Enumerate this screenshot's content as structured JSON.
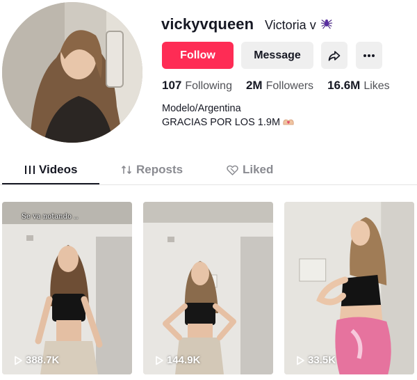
{
  "profile": {
    "username": "vickyvqueen",
    "display_name": "Victoria v",
    "name_emoji": "spider-icon",
    "bio_line1": "Modelo/Argentina",
    "bio_line2": "GRACIAS POR LOS 1.9M",
    "bio_emoji": "heart-hands-icon"
  },
  "actions": {
    "follow_label": "Follow",
    "message_label": "Message",
    "share_icon": "share-icon",
    "more_icon": "more-icon"
  },
  "stats": {
    "following_count": "107",
    "following_label": "Following",
    "followers_count": "2M",
    "followers_label": "Followers",
    "likes_count": "16.6M",
    "likes_label": "Likes"
  },
  "tabs": [
    {
      "label": "Videos",
      "icon": "grid-icon",
      "active": true
    },
    {
      "label": "Reposts",
      "icon": "repost-icon",
      "active": false
    },
    {
      "label": "Liked",
      "icon": "liked-heart-icon",
      "active": false
    }
  ],
  "videos": [
    {
      "views": "388.7K",
      "caption": "Se va notando .."
    },
    {
      "views": "144.9K",
      "caption": ""
    },
    {
      "views": "33.5K",
      "caption": ""
    }
  ],
  "colors": {
    "follow_bg": "#fe2c55",
    "button_bg": "#efefef",
    "text_primary": "#161823",
    "text_secondary": "#8a8b91"
  }
}
